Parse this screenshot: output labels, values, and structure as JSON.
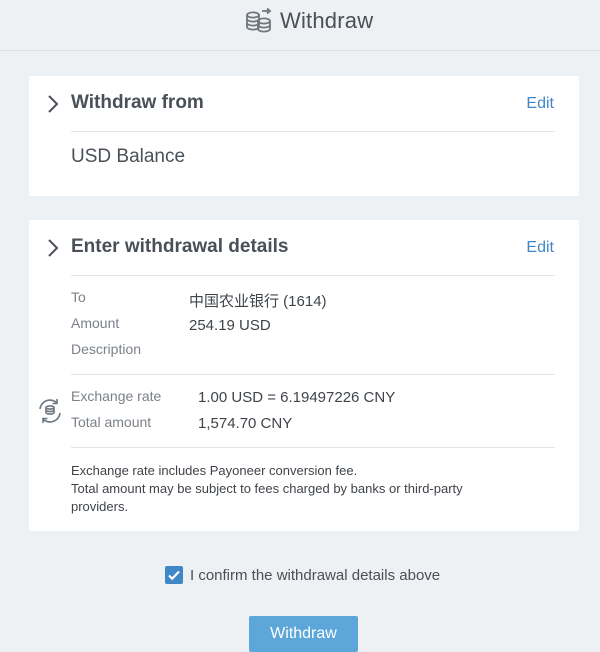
{
  "header": {
    "title": "Withdraw",
    "icon": "coins-transfer-icon"
  },
  "withdraw_from": {
    "title": "Withdraw from",
    "edit_label": "Edit",
    "balance": "USD Balance"
  },
  "details": {
    "title": "Enter withdrawal details",
    "edit_label": "Edit",
    "to_label": "To",
    "to_value": "中国农业银行 (1614)",
    "amount_label": "Amount",
    "amount_value": "254.19 USD",
    "description_label": "Description",
    "description_value": "",
    "exchange_rate_label": "Exchange rate",
    "exchange_rate_value": "1.00 USD = 6.19497226 CNY",
    "total_amount_label": "Total amount",
    "total_amount_value": "1,574.70 CNY",
    "note_lines": [
      "Exchange rate includes Payoneer conversion fee.",
      "Total amount may be subject to fees charged by banks or third-party",
      "providers."
    ]
  },
  "confirm": {
    "checked": true,
    "label": "I confirm the withdrawal details above"
  },
  "actions": {
    "withdraw_label": "Withdraw"
  },
  "colors": {
    "accent": "#3f87c7",
    "button": "#5ca6da",
    "background": "#eef1f3"
  }
}
